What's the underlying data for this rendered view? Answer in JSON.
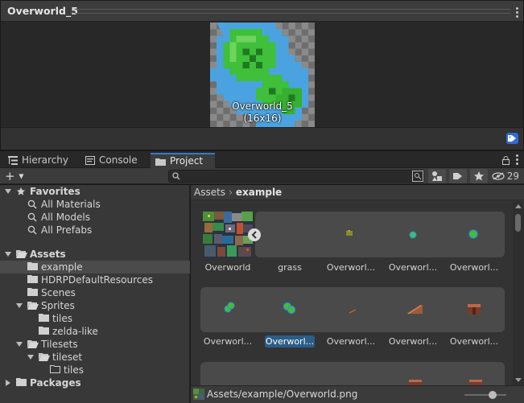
{
  "preview": {
    "title": "Overworld_5",
    "sprite_name": "Overworld_5",
    "sprite_size": "(16x16)",
    "tag_icon": "label-icon"
  },
  "tabs": [
    {
      "label": "Hierarchy",
      "icon": "hierarchy-icon"
    },
    {
      "label": "Console",
      "icon": "console-icon"
    },
    {
      "label": "Project",
      "icon": "folder-icon",
      "active": true
    }
  ],
  "toolbar": {
    "create_label": "+",
    "search_value": "",
    "hidden_count": "29"
  },
  "tree": {
    "favorites": "Favorites",
    "all_materials": "All Materials",
    "all_models": "All Models",
    "all_prefabs": "All Prefabs",
    "assets": "Assets",
    "example": "example",
    "hdrp": "HDRPDefaultResources",
    "scenes": "Scenes",
    "sprites": "Sprites",
    "tiles": "tiles",
    "zelda": "zelda-like",
    "tilesets": "Tilesets",
    "tileset": "tileset",
    "tileset_tiles": "tiles",
    "packages": "Packages"
  },
  "breadcrumb": {
    "root": "Assets",
    "current": "example"
  },
  "grid": {
    "row1": [
      "Overworld",
      "grass",
      "Overworl...",
      "Overworl...",
      "Overworl..."
    ],
    "row2": [
      "Overworl...",
      "Overworl...",
      "Overworl...",
      "Overworl...",
      "Overworl..."
    ],
    "selected": "Overworl..."
  },
  "status": {
    "path": "Assets/example/Overworld.png"
  },
  "colors": {
    "accent": "#3a79bb",
    "selection": "#2c5d87",
    "tag": "#2f6ad8"
  }
}
